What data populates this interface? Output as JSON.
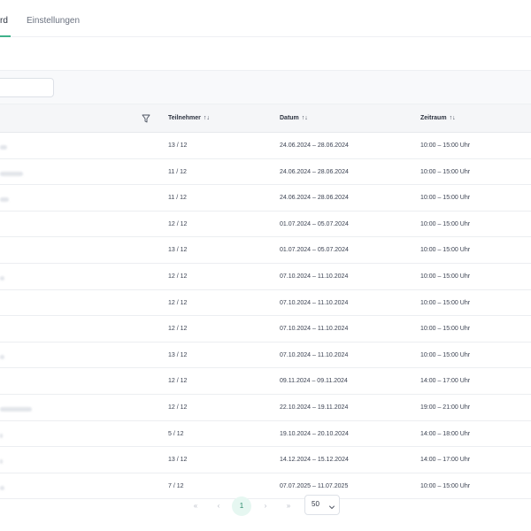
{
  "tabs": {
    "active": "rd",
    "inactive": "Einstellungen"
  },
  "table": {
    "headers": {
      "participants": "Teilnehmer",
      "date": "Datum",
      "time": "Zeitraum",
      "sort_symbol": "↑↓"
    },
    "rows": [
      {
        "participants": "13 / 12",
        "date": "24.06.2024 – 28.06.2024",
        "time": "10:00 – 15:00 Uhr"
      },
      {
        "participants": "11 / 12",
        "date": "24.06.2024 – 28.06.2024",
        "time": "10:00 – 15:00 Uhr"
      },
      {
        "participants": "11 / 12",
        "date": "24.06.2024 – 28.06.2024",
        "time": "10:00 – 15:00 Uhr"
      },
      {
        "participants": "12 / 12",
        "date": "01.07.2024 – 05.07.2024",
        "time": "10:00 – 15:00 Uhr"
      },
      {
        "participants": "13 / 12",
        "date": "01.07.2024 – 05.07.2024",
        "time": "10:00 – 15:00 Uhr"
      },
      {
        "participants": "12 / 12",
        "date": "07.10.2024 – 11.10.2024",
        "time": "10:00 – 15:00 Uhr"
      },
      {
        "participants": "12 / 12",
        "date": "07.10.2024 – 11.10.2024",
        "time": "10:00 – 15:00 Uhr"
      },
      {
        "participants": "12 / 12",
        "date": "07.10.2024 – 11.10.2024",
        "time": "10:00 – 15:00 Uhr"
      },
      {
        "participants": "13 / 12",
        "date": "07.10.2024 – 11.10.2024",
        "time": "10:00 – 15:00 Uhr"
      },
      {
        "participants": "12 / 12",
        "date": "09.11.2024 – 09.11.2024",
        "time": "14:00 – 17:00 Uhr"
      },
      {
        "participants": "12 / 12",
        "date": "22.10.2024 – 19.11.2024",
        "time": "19:00 – 21:00 Uhr"
      },
      {
        "participants": "5 / 12",
        "date": "19.10.2024 – 20.10.2024",
        "time": "14:00 – 18:00 Uhr"
      },
      {
        "participants": "13 / 12",
        "date": "14.12.2024 – 15.12.2024",
        "time": "14:00 – 17:00 Uhr"
      },
      {
        "participants": "7 / 12",
        "date": "07.07.2025 – 11.07.2025",
        "time": "10:00 – 15:00 Uhr"
      }
    ]
  },
  "pagination": {
    "first": "«",
    "prev": "‹",
    "current_page": "1",
    "next": "›",
    "last": "»",
    "per_page": "50"
  },
  "colors": {
    "accent": "#3fb18a"
  },
  "icons": {
    "filter": "filter-icon",
    "dropdown": "chevron-down-icon"
  }
}
